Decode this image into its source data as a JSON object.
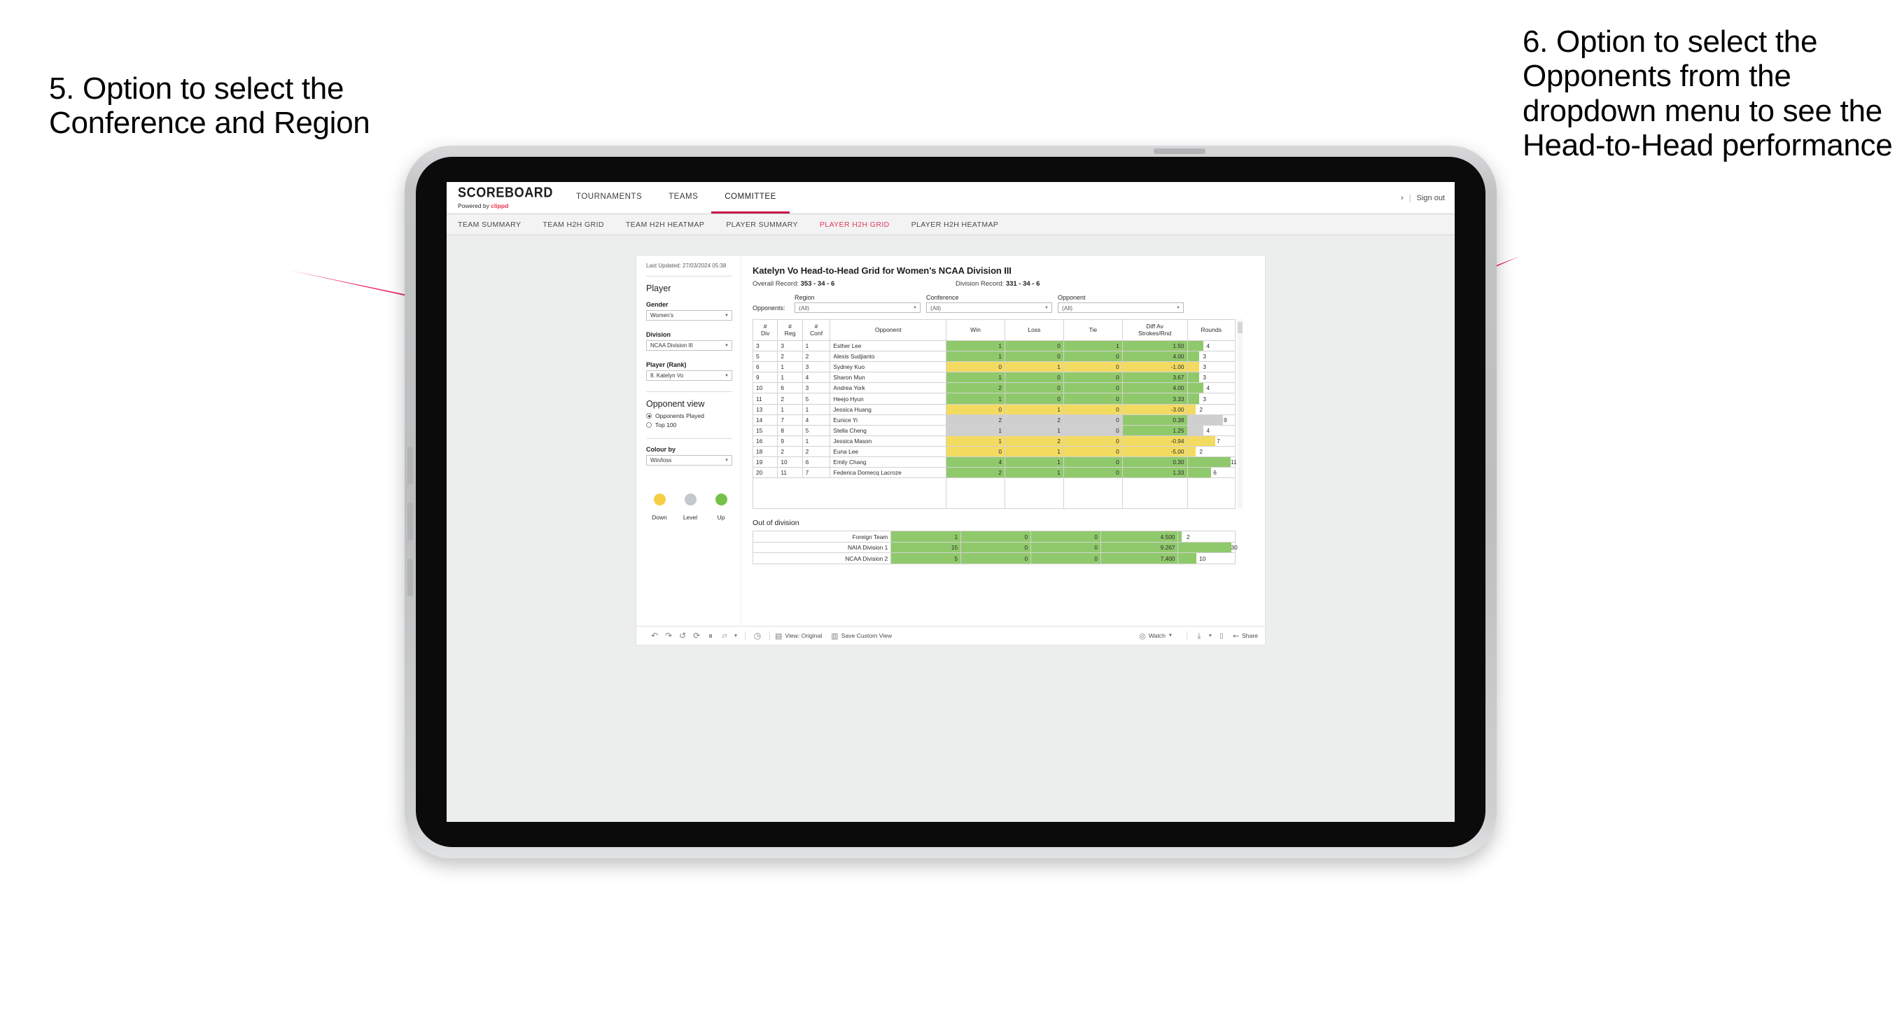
{
  "annotations": {
    "left": "5. Option to select the Conference and Region",
    "right": "6. Option to select the Opponents from the dropdown menu to see the Head-to-Head performance",
    "arrow_color": "#ea1f5e"
  },
  "app": {
    "brand": {
      "name": "SCOREBOARD",
      "powered_prefix": "Powered by ",
      "powered_brand": "clippd"
    },
    "topnav": [
      {
        "label": "TOURNAMENTS",
        "active": false
      },
      {
        "label": "TEAMS",
        "active": false
      },
      {
        "label": "COMMITTEE",
        "active": true
      }
    ],
    "topnav_right": {
      "chevron": "›",
      "divider": "|",
      "sign_out": "Sign out"
    },
    "subnav": [
      {
        "label": "TEAM SUMMARY",
        "active": false
      },
      {
        "label": "TEAM H2H GRID",
        "active": false
      },
      {
        "label": "TEAM H2H HEATMAP",
        "active": false
      },
      {
        "label": "PLAYER SUMMARY",
        "active": false
      },
      {
        "label": "PLAYER H2H GRID",
        "active": true
      },
      {
        "label": "PLAYER H2H HEATMAP",
        "active": false
      }
    ],
    "accent_color": "#c8194a",
    "active_tab_color": "#e0395e"
  },
  "sidebar": {
    "last_updated": "Last Updated: 27/03/2024 05:38",
    "player_heading": "Player",
    "gender": {
      "label": "Gender",
      "value": "Women’s"
    },
    "division": {
      "label": "Division",
      "value": "NCAA Division III"
    },
    "player_rank": {
      "label": "Player (Rank)",
      "value": "8. Katelyn Vo"
    },
    "opponent_view": {
      "heading": "Opponent view",
      "options": [
        {
          "label": "Opponents Played",
          "selected": true
        },
        {
          "label": "Top 100",
          "selected": false
        }
      ]
    },
    "colour_by": {
      "label": "Colour by",
      "value": "Win/loss"
    },
    "legend": [
      {
        "caption": "Down",
        "color": "#f5cf43"
      },
      {
        "caption": "Level",
        "color": "#c4c7cc"
      },
      {
        "caption": "Up",
        "color": "#76c04a"
      }
    ]
  },
  "viz": {
    "title": "Katelyn Vo Head-to-Head Grid for Women’s NCAA Division III",
    "overall_record_label": "Overall Record:",
    "overall_record_value": "353 - 34 - 6",
    "division_record_label": "Division Record:",
    "division_record_value": "331 -  34 - 6",
    "opponents_label": "Opponents:",
    "filters": [
      {
        "label": "Region",
        "value": "(All)"
      },
      {
        "label": "Conference",
        "value": "(All)"
      },
      {
        "label": "Opponent",
        "value": "(All)"
      }
    ]
  },
  "chart_data": {
    "type": "table",
    "title": "Katelyn Vo Head-to-Head Grid for Women’s NCAA Division III",
    "columns": [
      "# Div",
      "# Reg",
      "# Conf",
      "Opponent",
      "Win",
      "Loss",
      "Tie",
      "Diff Av Strokes/Rnd",
      "Rounds"
    ],
    "column_headers_multiline": [
      [
        "#",
        "Div"
      ],
      [
        "#",
        "Reg"
      ],
      [
        "#",
        "Conf"
      ],
      [
        "Opponent"
      ],
      [
        "Win"
      ],
      [
        "Loss"
      ],
      [
        "Tie"
      ],
      [
        "Diff Av",
        "Strokes/Rnd"
      ],
      [
        "Rounds"
      ]
    ],
    "rounds_max": 12,
    "rows": [
      {
        "div": "3",
        "reg": "3",
        "conf": "1",
        "opponent": "Esther Lee",
        "win": "1",
        "loss": "0",
        "tie": "1",
        "diff": "1.50",
        "rounds": "4",
        "state": "up"
      },
      {
        "div": "5",
        "reg": "2",
        "conf": "2",
        "opponent": "Alexis Sudjianto",
        "win": "1",
        "loss": "0",
        "tie": "0",
        "diff": "4.00",
        "rounds": "3",
        "state": "up"
      },
      {
        "div": "6",
        "reg": "1",
        "conf": "3",
        "opponent": "Sydney Kuo",
        "win": "0",
        "loss": "1",
        "tie": "0",
        "diff": "-1.00",
        "rounds": "3",
        "state": "down"
      },
      {
        "div": "9",
        "reg": "1",
        "conf": "4",
        "opponent": "Sharon Mun",
        "win": "1",
        "loss": "0",
        "tie": "0",
        "diff": "3.67",
        "rounds": "3",
        "state": "up"
      },
      {
        "div": "10",
        "reg": "6",
        "conf": "3",
        "opponent": "Andrea York",
        "win": "2",
        "loss": "0",
        "tie": "0",
        "diff": "4.00",
        "rounds": "4",
        "state": "up"
      },
      {
        "div": "11",
        "reg": "2",
        "conf": "5",
        "opponent": "Heejo Hyun",
        "win": "1",
        "loss": "0",
        "tie": "0",
        "diff": "3.33",
        "rounds": "3",
        "state": "up"
      },
      {
        "div": "13",
        "reg": "1",
        "conf": "1",
        "opponent": "Jessica Huang",
        "win": "0",
        "loss": "1",
        "tie": "0",
        "diff": "-3.00",
        "rounds": "2",
        "state": "down"
      },
      {
        "div": "14",
        "reg": "7",
        "conf": "4",
        "opponent": "Eunice Yi",
        "win": "2",
        "loss": "2",
        "tie": "0",
        "diff": "0.38",
        "rounds": "9",
        "state": "level",
        "diff_state": "up"
      },
      {
        "div": "15",
        "reg": "8",
        "conf": "5",
        "opponent": "Stella Cheng",
        "win": "1",
        "loss": "1",
        "tie": "0",
        "diff": "1.25",
        "rounds": "4",
        "state": "level",
        "diff_state": "up"
      },
      {
        "div": "16",
        "reg": "9",
        "conf": "1",
        "opponent": "Jessica Mason",
        "win": "1",
        "loss": "2",
        "tie": "0",
        "diff": "-0.94",
        "rounds": "7",
        "state": "down"
      },
      {
        "div": "18",
        "reg": "2",
        "conf": "2",
        "opponent": "Euna Lee",
        "win": "0",
        "loss": "1",
        "tie": "0",
        "diff": "-5.00",
        "rounds": "2",
        "state": "down"
      },
      {
        "div": "19",
        "reg": "10",
        "conf": "6",
        "opponent": "Emily Chang",
        "win": "4",
        "loss": "1",
        "tie": "0",
        "diff": "0.30",
        "rounds": "11",
        "state": "up"
      },
      {
        "div": "20",
        "reg": "11",
        "conf": "7",
        "opponent": "Federica Domecq Lacroze",
        "win": "2",
        "loss": "1",
        "tie": "0",
        "diff": "1.33",
        "rounds": "6",
        "state": "up"
      }
    ],
    "out_of_division": {
      "title": "Out of division",
      "rounds_max": 32,
      "rows": [
        {
          "name": "Foreign Team",
          "win": "1",
          "loss": "0",
          "tie": "0",
          "diff": "4.500",
          "rounds": "2",
          "state": "up"
        },
        {
          "name": "NAIA Division 1",
          "win": "15",
          "loss": "0",
          "tie": "0",
          "diff": "9.267",
          "rounds": "30",
          "state": "up"
        },
        {
          "name": "NCAA Division 2",
          "win": "5",
          "loss": "0",
          "tie": "0",
          "diff": "7.400",
          "rounds": "10",
          "state": "up"
        }
      ]
    },
    "colors": {
      "up": "#90c96b",
      "down": "#f3db61",
      "level": "#cfcfcf"
    }
  },
  "toolbar": {
    "icons": [
      "undo-icon",
      "redo-icon",
      "revert-icon",
      "refresh-icon",
      "pause-icon",
      "highlight-icon"
    ],
    "view_label": "View: Original",
    "save_custom_view_label": "Save Custom View",
    "watch_label": "Watch",
    "share_label": "Share"
  }
}
